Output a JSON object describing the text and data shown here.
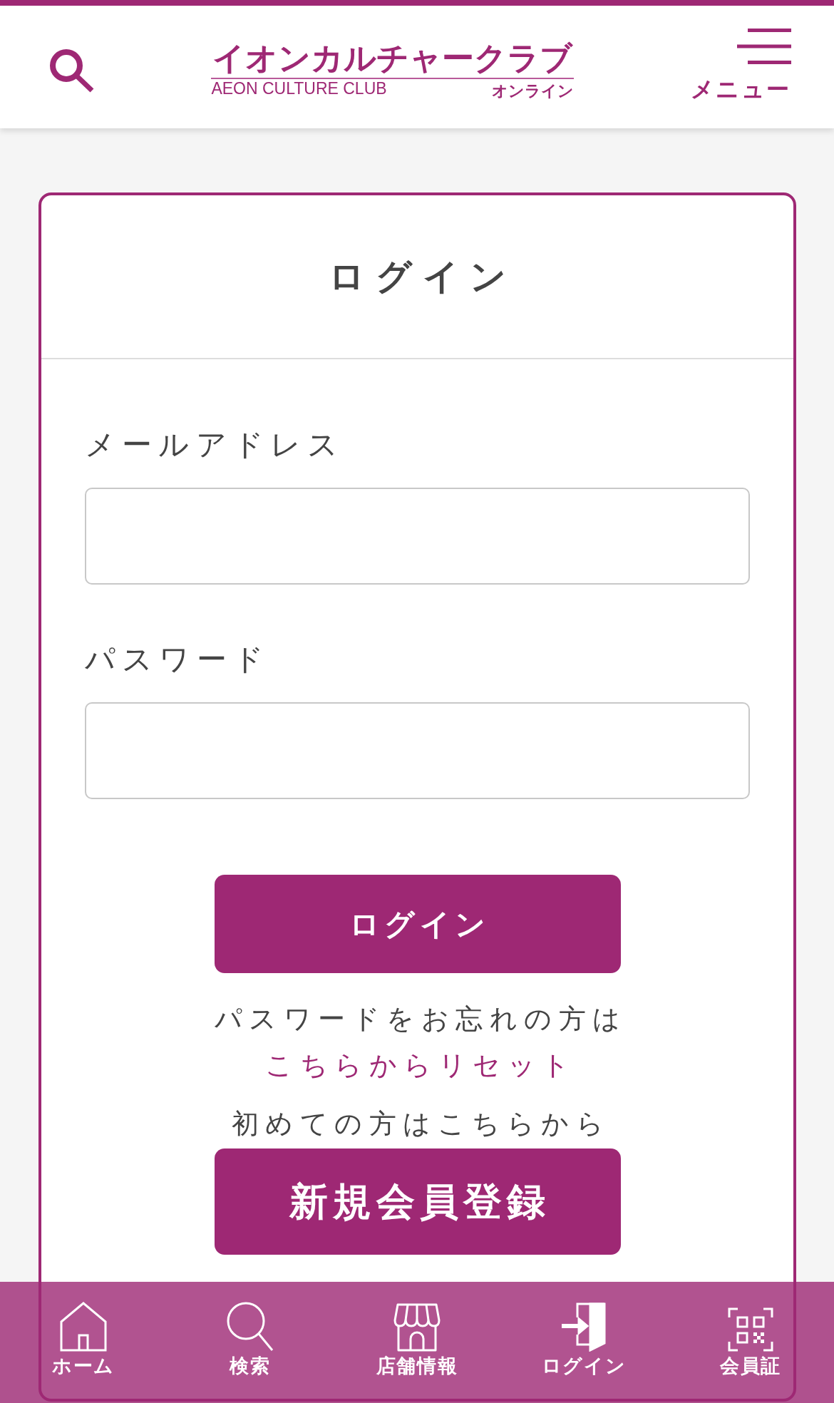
{
  "header": {
    "logo": {
      "wordmark": "イオンカルチャークラブ",
      "subtitle": "AEON CULTURE CLUB",
      "tagline": "オンライン"
    },
    "menu_label": "メニュー"
  },
  "login_card": {
    "title": "ログイン",
    "fields": [
      {
        "label": "メールアドレス"
      },
      {
        "label": "パスワード"
      }
    ],
    "login_button": "ログイン",
    "forgot_password": {
      "text": "パスワードをお忘れの方は",
      "link": "こちらからリセット"
    },
    "first_time_text": "初めての方はこちらから",
    "register_button": "新規会員登録"
  },
  "bottom_nav": [
    {
      "label": "ホーム"
    },
    {
      "label": "検索"
    },
    {
      "label": "店舗情報"
    },
    {
      "label": "ログイン"
    },
    {
      "label": "会員証"
    }
  ]
}
